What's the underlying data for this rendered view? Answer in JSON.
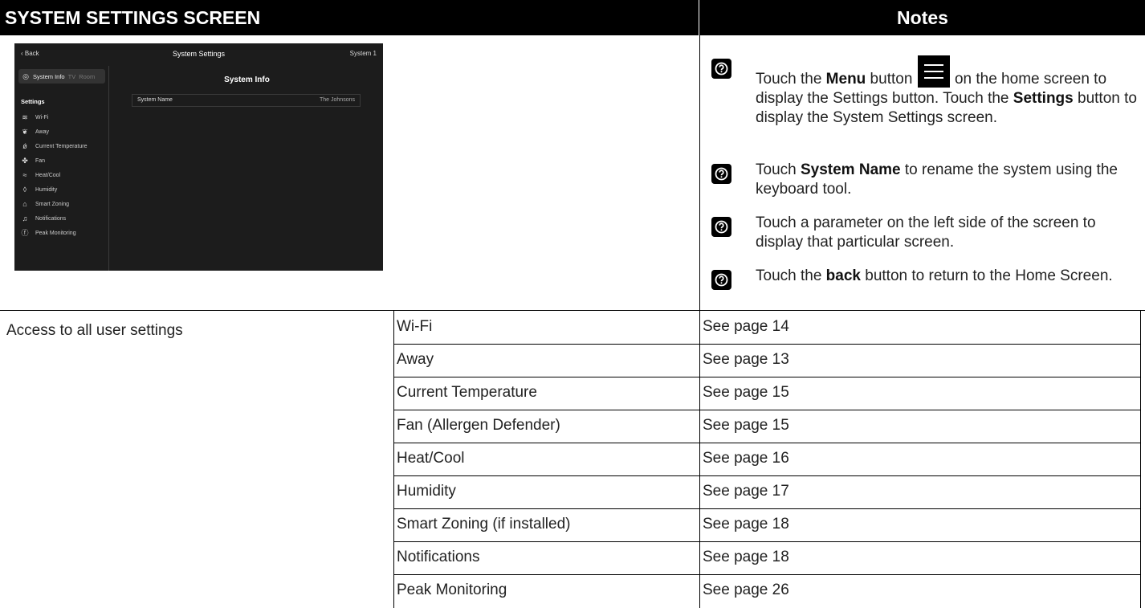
{
  "header": {
    "left_title": "SYSTEM SETTINGS SCREEN",
    "right_title": "Notes"
  },
  "device": {
    "back_label": "Back",
    "title": "System Settings",
    "system_label": "System 1",
    "tabs": {
      "active": "System Info",
      "tv": "TV",
      "room": "Room"
    },
    "settings_heading": "Settings",
    "items": [
      {
        "icon": "wifi-icon",
        "label": "Wi-Fi"
      },
      {
        "icon": "leaf-icon",
        "label": "Away"
      },
      {
        "icon": "thermometer-icon",
        "label": "Current Temperature"
      },
      {
        "icon": "fan-icon",
        "label": "Fan"
      },
      {
        "icon": "heat-cool-icon",
        "label": "Heat/Cool"
      },
      {
        "icon": "droplet-icon",
        "label": "Humidity"
      },
      {
        "icon": "zoning-icon",
        "label": "Smart Zoning"
      },
      {
        "icon": "bell-icon",
        "label": "Notifications"
      },
      {
        "icon": "bolt-icon",
        "label": "Peak Monitoring"
      }
    ],
    "info_title": "System Info",
    "info_row_label": "System Name",
    "info_row_value": "The Johnsons"
  },
  "notes": {
    "n1": {
      "a": "Touch the ",
      "b": "Menu",
      "c": " button ",
      "d": " on the home screen to display the Settings button. Touch the ",
      "e": "Settings",
      "f": " button to display the System Settings screen."
    },
    "n2": {
      "a": "Touch ",
      "b": "System Name",
      "c": " to rename the system using the keyboard tool."
    },
    "n3": {
      "a": "Touch a parameter on the left side of the screen to display that particular screen."
    },
    "n4": {
      "a": "Touch the ",
      "b": "back",
      "c": " button to return to the Home Screen."
    }
  },
  "table": {
    "description": "Access to all user settings",
    "rows": [
      {
        "setting": "Wi-Fi",
        "page": "See page 14"
      },
      {
        "setting": "Away",
        "page": "See page 13"
      },
      {
        "setting": "Current Temperature",
        "page": "See page 15"
      },
      {
        "setting": "Fan (Allergen Defender)",
        "page": "See page 15"
      },
      {
        "setting": "Heat/Cool",
        "page": "See page 16"
      },
      {
        "setting": "Humidity",
        "page": "See page 17"
      },
      {
        "setting": "Smart Zoning (if installed)",
        "page": "See page 18"
      },
      {
        "setting": "Notifications",
        "page": "See page 18"
      },
      {
        "setting": "Peak Monitoring",
        "page": "See page 26"
      }
    ]
  }
}
